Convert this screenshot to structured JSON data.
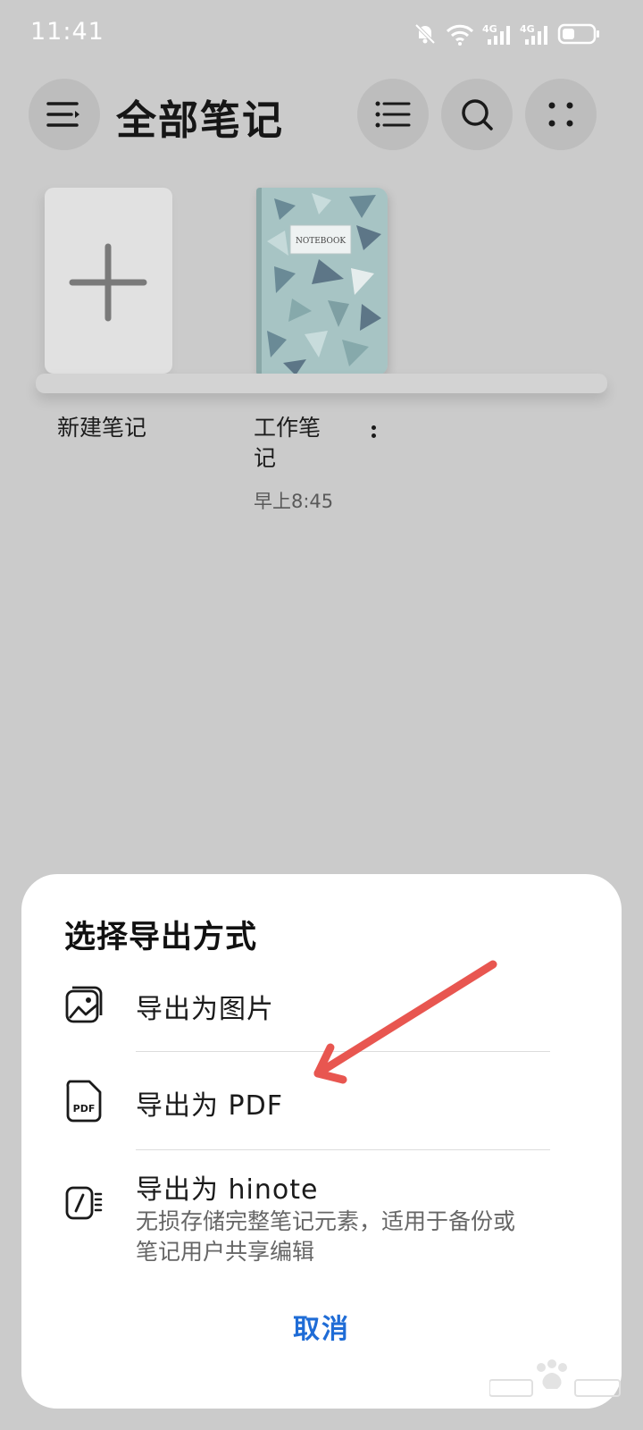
{
  "status": {
    "time": "11:41",
    "network_label": "4G"
  },
  "header": {
    "title": "全部笔记"
  },
  "notes": {
    "new_note_label": "新建笔记",
    "notebook_label_line1": "工作笔",
    "notebook_label_line2": "记",
    "notebook_time": "早上8:45",
    "cover_title": "NOTEBOOK"
  },
  "sheet": {
    "title": "选择导出方式",
    "options": [
      {
        "label": "导出为图片"
      },
      {
        "label": "导出为 PDF",
        "icon_text": "PDF"
      },
      {
        "label": "导出为 hinote",
        "desc_line1": "无损存储完整笔记元素，适用于备份或",
        "desc_line2": "笔记用户共享编辑"
      }
    ],
    "cancel_label": "取消"
  },
  "colors": {
    "accent": "#1f6cd6",
    "annotation_arrow": "#e85650",
    "background": "#cbcbcb"
  }
}
